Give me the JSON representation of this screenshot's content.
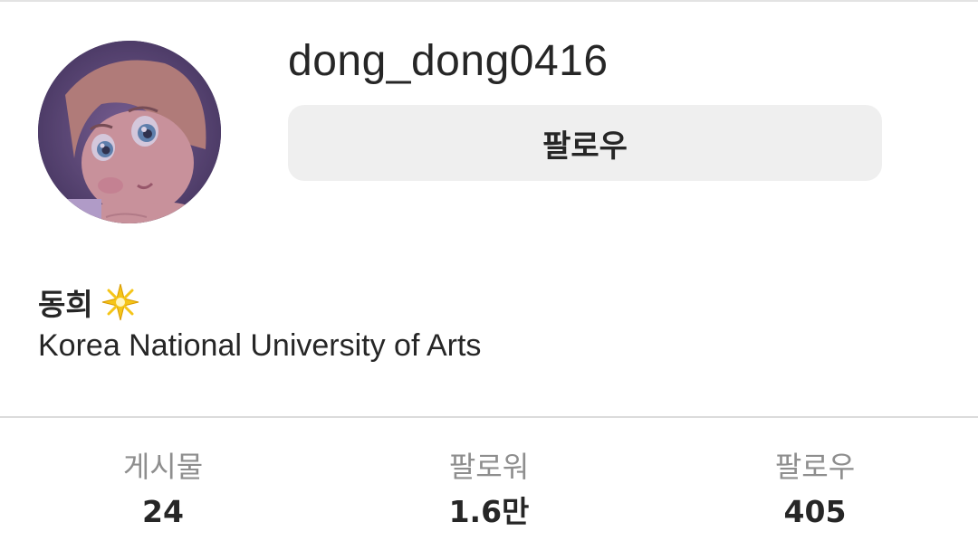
{
  "profile": {
    "username": "dong_dong0416",
    "follow_button_label": "팔로우",
    "display_name": "동희",
    "display_name_emoji": "sparkle-icon",
    "bio": "Korea National University of Arts"
  },
  "stats": [
    {
      "label": "게시물",
      "value": "24"
    },
    {
      "label": "팔로워",
      "value": "1.6만"
    },
    {
      "label": "팔로우",
      "value": "405"
    }
  ],
  "colors": {
    "button_bg": "#efefef",
    "text_primary": "#262626",
    "text_secondary": "#8e8e8e",
    "divider": "#dbdbdb"
  }
}
